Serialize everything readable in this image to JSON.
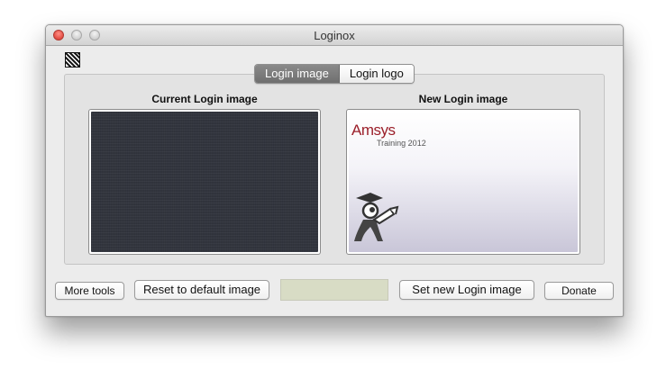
{
  "window": {
    "title": "Loginox"
  },
  "tabs": [
    {
      "label": "Login image",
      "active": true
    },
    {
      "label": "Login logo",
      "active": false
    }
  ],
  "current": {
    "label": "Current Login image"
  },
  "new_image": {
    "label": "New Login image",
    "brand": "Amsys",
    "subtitle": "Training 2012",
    "brand_color": "#9b1f2a"
  },
  "buttons": {
    "more_tools": "More tools",
    "reset": "Reset to default image",
    "set_new": "Set new Login image",
    "donate": "Donate"
  },
  "status_field_color": "#d8dcc5",
  "icons": [
    "close-icon",
    "minimize-icon",
    "zoom-icon",
    "app-icon",
    "mascot-icon"
  ]
}
